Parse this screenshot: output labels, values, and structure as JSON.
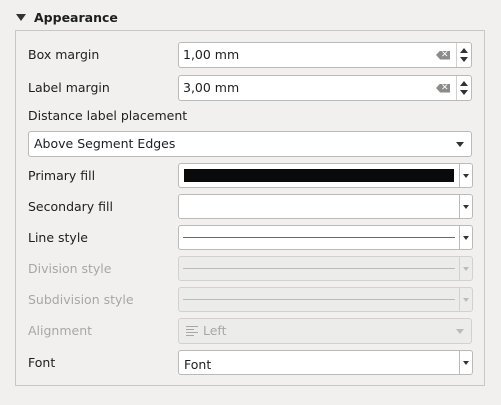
{
  "group": {
    "title": "Appearance"
  },
  "box_margin": {
    "label": "Box margin",
    "value": "1,00 mm"
  },
  "label_margin": {
    "label": "Label margin",
    "value": "3,00 mm"
  },
  "distance_label_placement": {
    "label": "Distance label placement",
    "selected": "Above Segment Edges"
  },
  "primary_fill": {
    "label": "Primary fill",
    "color": "#0a0a0a"
  },
  "secondary_fill": {
    "label": "Secondary fill",
    "color": "#ffffff"
  },
  "line_style": {
    "label": "Line style",
    "color": "#e53535"
  },
  "division_style": {
    "label": "Division style",
    "enabled": false
  },
  "subdivision_style": {
    "label": "Subdivision style",
    "enabled": false
  },
  "alignment": {
    "label": "Alignment",
    "selected": "Left",
    "enabled": false
  },
  "font": {
    "label": "Font",
    "value": "Font"
  }
}
